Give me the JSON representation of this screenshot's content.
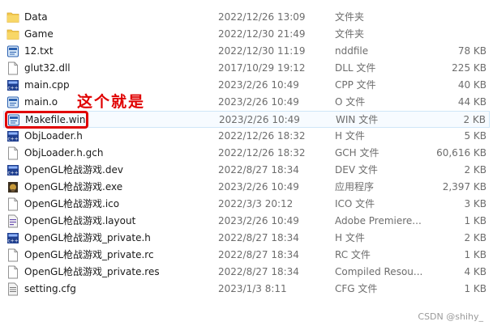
{
  "files": [
    {
      "name": "Data",
      "date": "2022/12/26 13:09",
      "type": "文件夹",
      "size": "",
      "icon": "folder-icon"
    },
    {
      "name": "Game",
      "date": "2022/12/30 21:49",
      "type": "文件夹",
      "size": "",
      "icon": "folder-icon"
    },
    {
      "name": "12.txt",
      "date": "2022/12/30 11:19",
      "type": "nddfile",
      "size": "78 KB",
      "icon": "dev-source-icon"
    },
    {
      "name": "glut32.dll",
      "date": "2017/10/29 19:12",
      "type": "DLL 文件",
      "size": "225 KB",
      "icon": "generic-file-icon"
    },
    {
      "name": "main.cpp",
      "date": "2023/2/26 10:49",
      "type": "CPP 文件",
      "size": "40 KB",
      "icon": "dev-cpp-icon"
    },
    {
      "name": "main.o",
      "date": "2023/2/26 10:49",
      "type": "O 文件",
      "size": "44 KB",
      "icon": "dev-source-icon"
    },
    {
      "name": "Makefile.win",
      "date": "2023/2/26 10:49",
      "type": "WIN 文件",
      "size": "2 KB",
      "icon": "dev-source-icon"
    },
    {
      "name": "ObjLoader.h",
      "date": "2022/12/26 18:32",
      "type": "H 文件",
      "size": "5 KB",
      "icon": "dev-cpp-icon"
    },
    {
      "name": "ObjLoader.h.gch",
      "date": "2022/12/26 18:32",
      "type": "GCH 文件",
      "size": "60,616 KB",
      "icon": "generic-file-icon"
    },
    {
      "name": "OpenGL枪战游戏.dev",
      "date": "2022/8/27 18:34",
      "type": "DEV 文件",
      "size": "2 KB",
      "icon": "dev-cpp-icon"
    },
    {
      "name": "OpenGL枪战游戏.exe",
      "date": "2023/2/26 10:49",
      "type": "应用程序",
      "size": "2,397 KB",
      "icon": "exe-icon"
    },
    {
      "name": "OpenGL枪战游戏.ico",
      "date": "2022/3/3 20:12",
      "type": "ICO 文件",
      "size": "3 KB",
      "icon": "generic-file-icon"
    },
    {
      "name": "OpenGL枪战游戏.layout",
      "date": "2023/2/26 10:49",
      "type": "Adobe Premiere...",
      "size": "1 KB",
      "icon": "layout-icon"
    },
    {
      "name": "OpenGL枪战游戏_private.h",
      "date": "2022/8/27 18:34",
      "type": "H 文件",
      "size": "2 KB",
      "icon": "dev-cpp-icon"
    },
    {
      "name": "OpenGL枪战游戏_private.rc",
      "date": "2022/8/27 18:34",
      "type": "RC 文件",
      "size": "1 KB",
      "icon": "generic-file-icon"
    },
    {
      "name": "OpenGL枪战游戏_private.res",
      "date": "2022/8/27 18:34",
      "type": "Compiled Resou...",
      "size": "4 KB",
      "icon": "generic-file-icon"
    },
    {
      "name": "setting.cfg",
      "date": "2023/1/3 8:11",
      "type": "CFG 文件",
      "size": "1 KB",
      "icon": "config-icon"
    }
  ],
  "annotation": {
    "text": "这个就是",
    "color": "#e00000"
  },
  "watermark": "CSDN @shihy_",
  "colors": {
    "folder": "#f3c94f",
    "selected_border": "#cfe6f7",
    "dev_blue": "#1f3f8f"
  }
}
